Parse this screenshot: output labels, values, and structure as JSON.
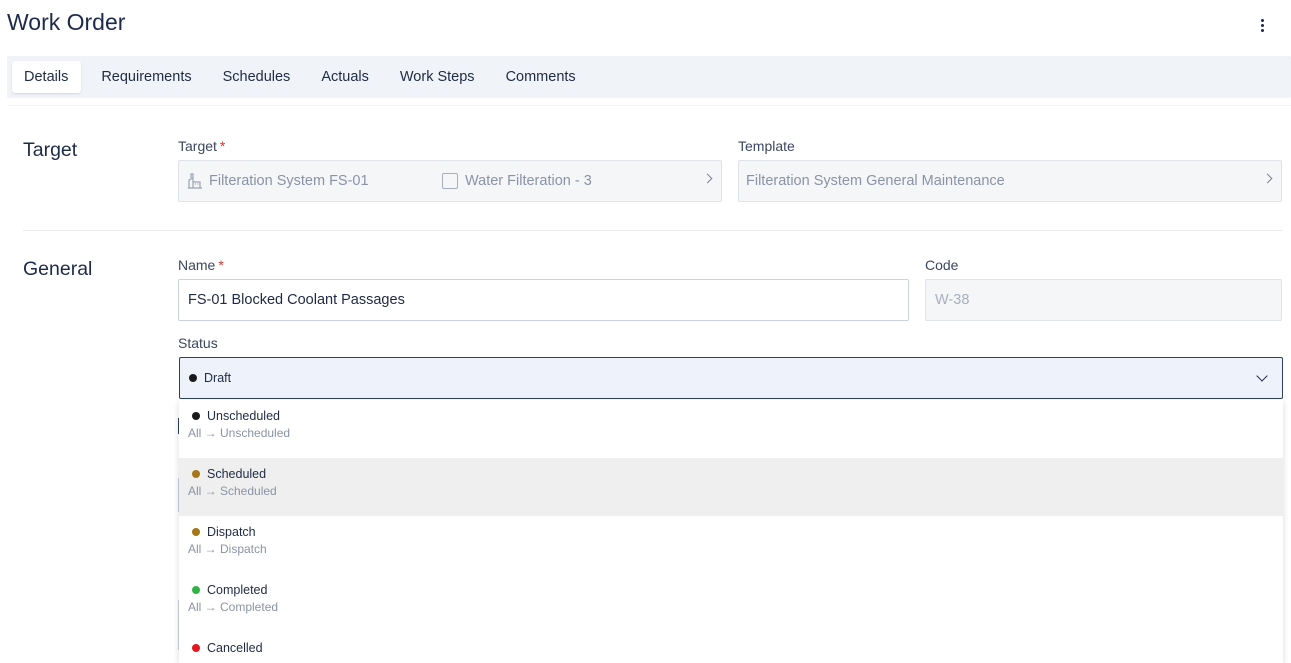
{
  "header": {
    "title": "Work Order"
  },
  "tabs": [
    {
      "label": "Details",
      "active": true
    },
    {
      "label": "Requirements"
    },
    {
      "label": "Schedules"
    },
    {
      "label": "Actuals"
    },
    {
      "label": "Work Steps"
    },
    {
      "label": "Comments"
    }
  ],
  "target_section": {
    "title": "Target",
    "target_label": "Target",
    "target_asset": "Filteration System FS-01",
    "target_subasset": "Water Filteration - 3",
    "template_label": "Template",
    "template_value": "Filteration System General Maintenance"
  },
  "general_section": {
    "title": "General",
    "name_label": "Name",
    "name_value": "FS-01 Blocked Coolant Passages",
    "code_label": "Code",
    "code_value": "W-38",
    "status_label": "Status",
    "status_selected": "Draft",
    "status_selected_color": "#1a1a1a"
  },
  "status_options": [
    {
      "label": "Unscheduled",
      "path": "All → Unscheduled",
      "color": "#1a1a1a"
    },
    {
      "label": "Scheduled",
      "path": "All → Scheduled",
      "color": "#a77717"
    },
    {
      "label": "Dispatch",
      "path": "All → Dispatch",
      "color": "#a77717"
    },
    {
      "label": "Completed",
      "path": "All → Completed",
      "color": "#2fb344"
    },
    {
      "label": "Cancelled",
      "path": "",
      "color": "#e5161e"
    }
  ],
  "required_marker": "*"
}
